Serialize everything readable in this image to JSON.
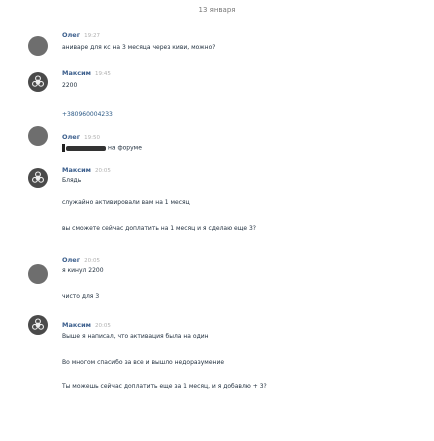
{
  "date_divider": "13 января",
  "messages": [
    {
      "author": "Олег",
      "time": "19:27",
      "text": "аниваре для кс на 3 месяца через киви, можно?"
    },
    {
      "author": "Максим",
      "time": "19:45",
      "text": "2200"
    },
    {
      "author": "",
      "time": "",
      "text": "+380960004233"
    },
    {
      "author": "Олег",
      "time": "19:50",
      "text": "на форуме"
    },
    {
      "author": "Максим",
      "time": "20:05",
      "text": "Блядь"
    },
    {
      "author": "",
      "time": "",
      "text": "служайно активировали вам на 1 месяц"
    },
    {
      "author": "",
      "time": "",
      "text": "вы сможете сейчас доплатить на 1 месяц и я сделаю еще 3?"
    },
    {
      "author": "Олег",
      "time": "20:05",
      "text": "я кинул 2200"
    },
    {
      "author": "",
      "time": "",
      "text": "чисто для 3"
    },
    {
      "author": "Максим",
      "time": "20:05",
      "text": "Выше я написал, что активация была на один"
    },
    {
      "author": "",
      "time": "",
      "text": "Во многом спасибо за все и вышло недоразумение"
    },
    {
      "author": "",
      "time": "",
      "text": "Ты можешь сейчас доплатить еще за 1 месяц, и я добавлю + 3?"
    }
  ],
  "avatars": [
    {
      "name": "avatar-oleg",
      "icon": "user-icon"
    },
    {
      "name": "avatar-maksim",
      "icon": "biohazard-icon"
    }
  ]
}
